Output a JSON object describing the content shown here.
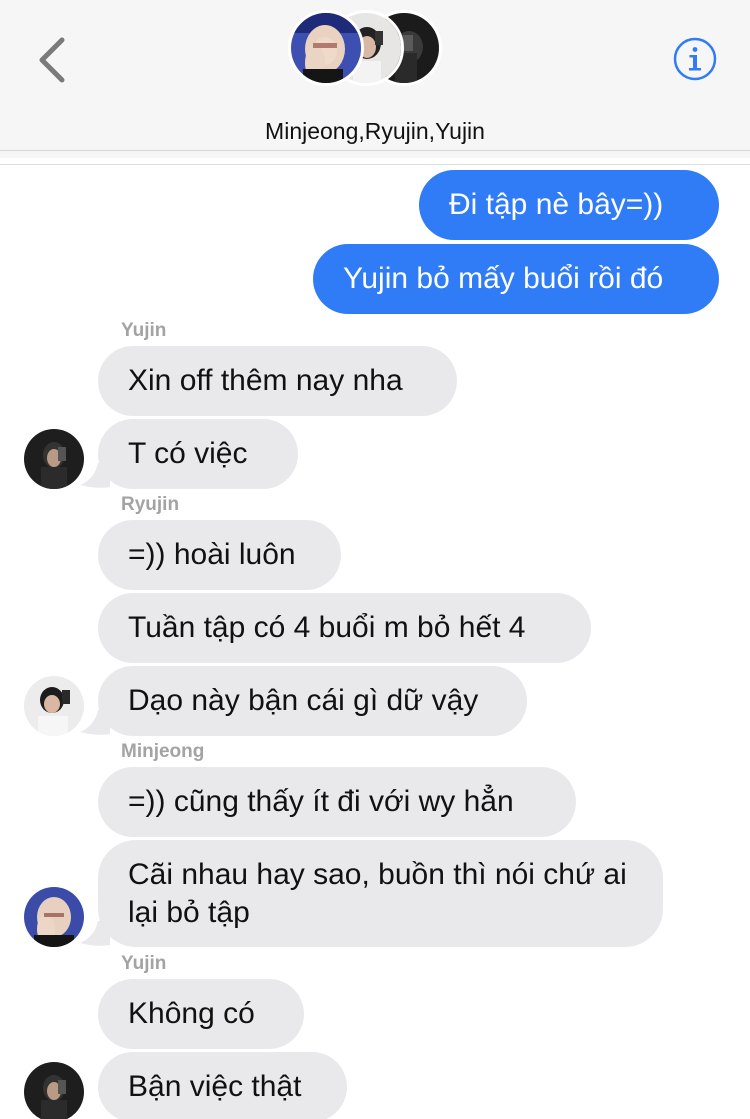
{
  "header": {
    "group_title": "Minjeong,Ryujin,Yujin",
    "back_icon": "chevron-left-icon",
    "info_icon": "info-circle-icon",
    "accent_color": "#2f7cf6"
  },
  "messages": {
    "outgoing": [
      "Đi tập nè bây=))",
      "Yujin bỏ mấy buổi rồi đó"
    ],
    "group1": {
      "sender": "Yujin",
      "texts": [
        "Xin off thêm nay nha",
        "T có việc"
      ]
    },
    "group2": {
      "sender": "Ryujin",
      "texts": [
        "=)) hoài luôn",
        "Tuần tập có 4 buổi m bỏ hết 4",
        "Dạo này bận cái gì dữ vậy"
      ]
    },
    "group3": {
      "sender": "Minjeong",
      "texts": [
        "=)) cũng thấy ít đi với wy hẳn",
        "Cãi nhau hay sao, buồn thì nói chứ ai lại bỏ tập"
      ]
    },
    "group4": {
      "sender": "Yujin",
      "texts": [
        "Không có",
        "Bận việc thật"
      ]
    }
  },
  "colors": {
    "outgoing_bubble": "#2f7cf6",
    "incoming_bubble": "#e9e9ec",
    "sender_label": "#a3a3a3"
  }
}
